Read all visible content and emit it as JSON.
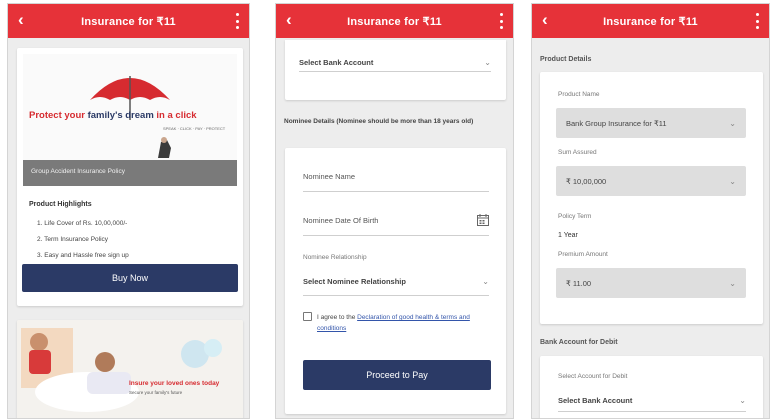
{
  "screens": [
    {
      "header": {
        "title": "Insurance for ₹11"
      },
      "banner": {
        "headline": [
          "Protect ",
          "your ",
          "family's dream",
          " in a click"
        ],
        "tagline": "SPEAK · CLICK · PAY · PROTECT",
        "overlay_caption": "Group Accident Insurance Policy"
      },
      "highlights": {
        "heading": "Product Highlights",
        "items": [
          "Life Cover of Rs. 10,00,000/-",
          "Term Insurance Policy",
          "Easy and Hassle free sign up"
        ]
      },
      "buy_button": "Buy Now",
      "promo": {
        "caption": "Insure your loved ones today",
        "subcaption": "Secure your family's future"
      }
    },
    {
      "header": {
        "title": "Insurance for ₹11"
      },
      "select_account": "Select Bank Account",
      "nominee_banner": "Nominee Details (Nominee should be more than 18 years old)",
      "fields": {
        "name_placeholder": "Nominee Name",
        "dob_placeholder": "Nominee Date Of Birth",
        "relationship_label": "Nominee Relationship",
        "relationship_value": "Select Nominee Relationship"
      },
      "consent": {
        "prefix": "I agree to the ",
        "link": "Declaration of good health & terms and conditions"
      },
      "proceed_button": "Proceed to Pay"
    },
    {
      "header": {
        "title": "Insurance for ₹11"
      },
      "section_title": "Product Details",
      "product_name_label": "Product Name",
      "product_name_value": "Bank Group Insurance for ₹11",
      "sum_assured_label": "Sum Assured",
      "sum_assured_value": "₹ 10,00,000",
      "policy_term_label": "Policy Term",
      "policy_term_value": "1 Year",
      "premium_label": "Premium Amount",
      "premium_value": "₹ 11.00",
      "bank_section": "Bank Account for Debit",
      "account_label": "Select Account for Debit",
      "account_value": "Select Bank Account"
    }
  ],
  "colors": {
    "header": "#e63239",
    "primary_button": "#2b3a66",
    "umbrella": "#d62b30",
    "link": "#3355aa"
  },
  "icons": {
    "back": "back-arrow-icon",
    "menu": "kebab-menu-icon",
    "calendar": "calendar-icon",
    "chevron": "chevron-down-icon"
  }
}
